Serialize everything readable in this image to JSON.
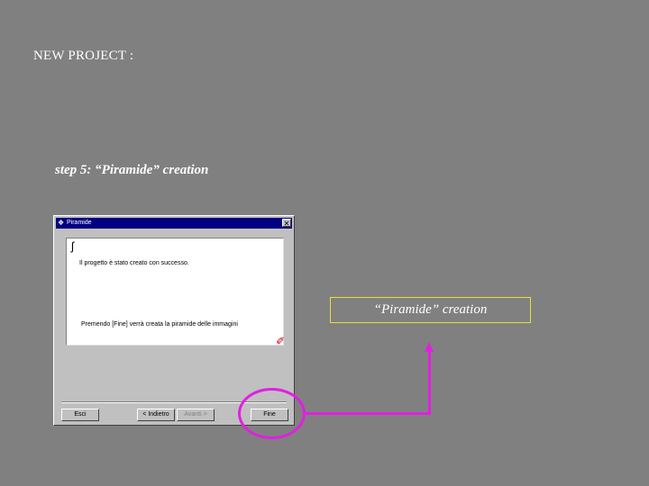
{
  "slide": {
    "title": "NEW PROJECT :",
    "step_caption": "step 5: “Piramide” creation"
  },
  "dialog": {
    "title": "Piramide",
    "app_icon": "❖",
    "close_glyph": "✕",
    "panel_icon": "ʃ",
    "info_text": "Il progetto è stato creato con successo.",
    "hint_text": "Premendo [Fine] verrà creata la piramide delle immagini",
    "cursor_glyph": "✐",
    "buttons": {
      "exit": "Esci",
      "back": "< Indietro",
      "next": "Avanti >",
      "end": "Fine"
    }
  },
  "callout": {
    "label": "“Piramide” creation",
    "highlight_color": "#e020e0",
    "border_color": "#e8e030"
  }
}
